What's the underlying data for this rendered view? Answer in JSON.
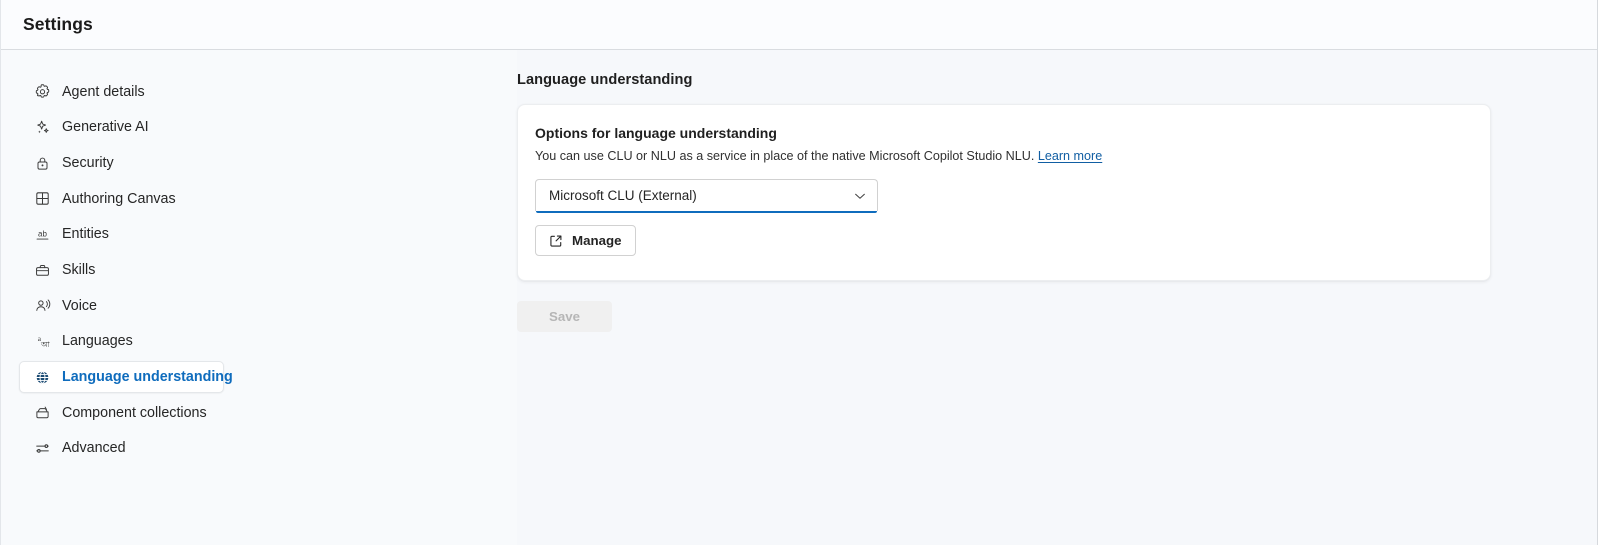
{
  "header": {
    "title": "Settings"
  },
  "sidebar": {
    "items": [
      {
        "id": "agent-details",
        "label": "Agent details",
        "icon": "gear-icon",
        "selected": false
      },
      {
        "id": "generative-ai",
        "label": "Generative AI",
        "icon": "sparkle-icon",
        "selected": false
      },
      {
        "id": "security",
        "label": "Security",
        "icon": "lock-icon",
        "selected": false
      },
      {
        "id": "authoring-canvas",
        "label": "Authoring Canvas",
        "icon": "grid-icon",
        "selected": false
      },
      {
        "id": "entities",
        "label": "Entities",
        "icon": "ab-text-icon",
        "selected": false
      },
      {
        "id": "skills",
        "label": "Skills",
        "icon": "briefcase-icon",
        "selected": false
      },
      {
        "id": "voice",
        "label": "Voice",
        "icon": "person-speaking-icon",
        "selected": false
      },
      {
        "id": "languages",
        "label": "Languages",
        "icon": "translate-icon",
        "selected": false
      },
      {
        "id": "language-understanding",
        "label": "Language understanding",
        "icon": "globe-icon",
        "selected": true
      },
      {
        "id": "component-collections",
        "label": "Component collections",
        "icon": "collections-icon",
        "selected": false
      },
      {
        "id": "advanced",
        "label": "Advanced",
        "icon": "sliders-icon",
        "selected": false
      }
    ]
  },
  "main": {
    "section_title": "Language understanding",
    "card": {
      "heading": "Options for language understanding",
      "description_text": "You can use CLU or NLU as a service in place of the native Microsoft Copilot Studio NLU.",
      "learn_more_label": "Learn more",
      "dropdown": {
        "selected": "Microsoft CLU (External)",
        "options": [
          "Microsoft CLU (External)"
        ],
        "chevron_icon": "chevron-down-icon"
      },
      "manage_button": {
        "label": "Manage",
        "icon": "external-link-icon"
      }
    },
    "save_button": {
      "label": "Save",
      "disabled": true
    }
  },
  "colors": {
    "accent": "#0f6cbd",
    "link": "#115ea3",
    "page_background": "#f6f8fb",
    "card_background": "#ffffff",
    "disabled_text": "#b6b6b6"
  }
}
